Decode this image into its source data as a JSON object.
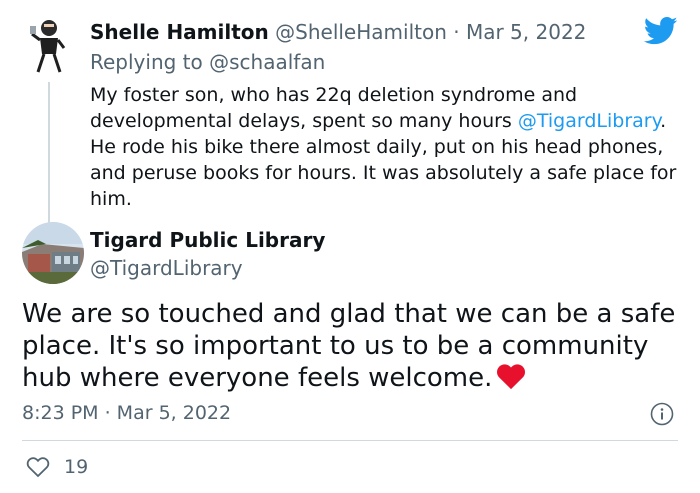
{
  "reply": {
    "name": "Shelle Hamilton",
    "handle": "@ShelleHamilton",
    "separator": "·",
    "date": "Mar 5, 2022",
    "replying_prefix": "Replying to",
    "replying_to": "@schaalfan",
    "body_part1": "My foster son, who has 22q deletion syndrome and developmental delays, spent so many hours ",
    "body_mention": "@TigardLibrary",
    "body_part2": ". He rode his bike there almost daily, put on his head phones, and peruse books for hours. It was absolutely a safe place for him."
  },
  "tweet": {
    "name": "Tigard Public Library",
    "handle": "@TigardLibrary",
    "body": "We are so touched and glad that we can be a safe place. It's so important to us to be a community hub where everyone feels welcome.",
    "timestamp": "8:23 PM · Mar 5, 2022",
    "like_count": "19"
  },
  "icons": {
    "brand": "twitter-bird-icon",
    "info": "info-icon",
    "like": "heart-outline-icon",
    "emoji": "red-heart-emoji"
  },
  "colors": {
    "accent": "#1d9bf0",
    "muted": "#536471",
    "text": "#0f1419",
    "heart": "#e8112d",
    "divider": "#cfd9de"
  }
}
